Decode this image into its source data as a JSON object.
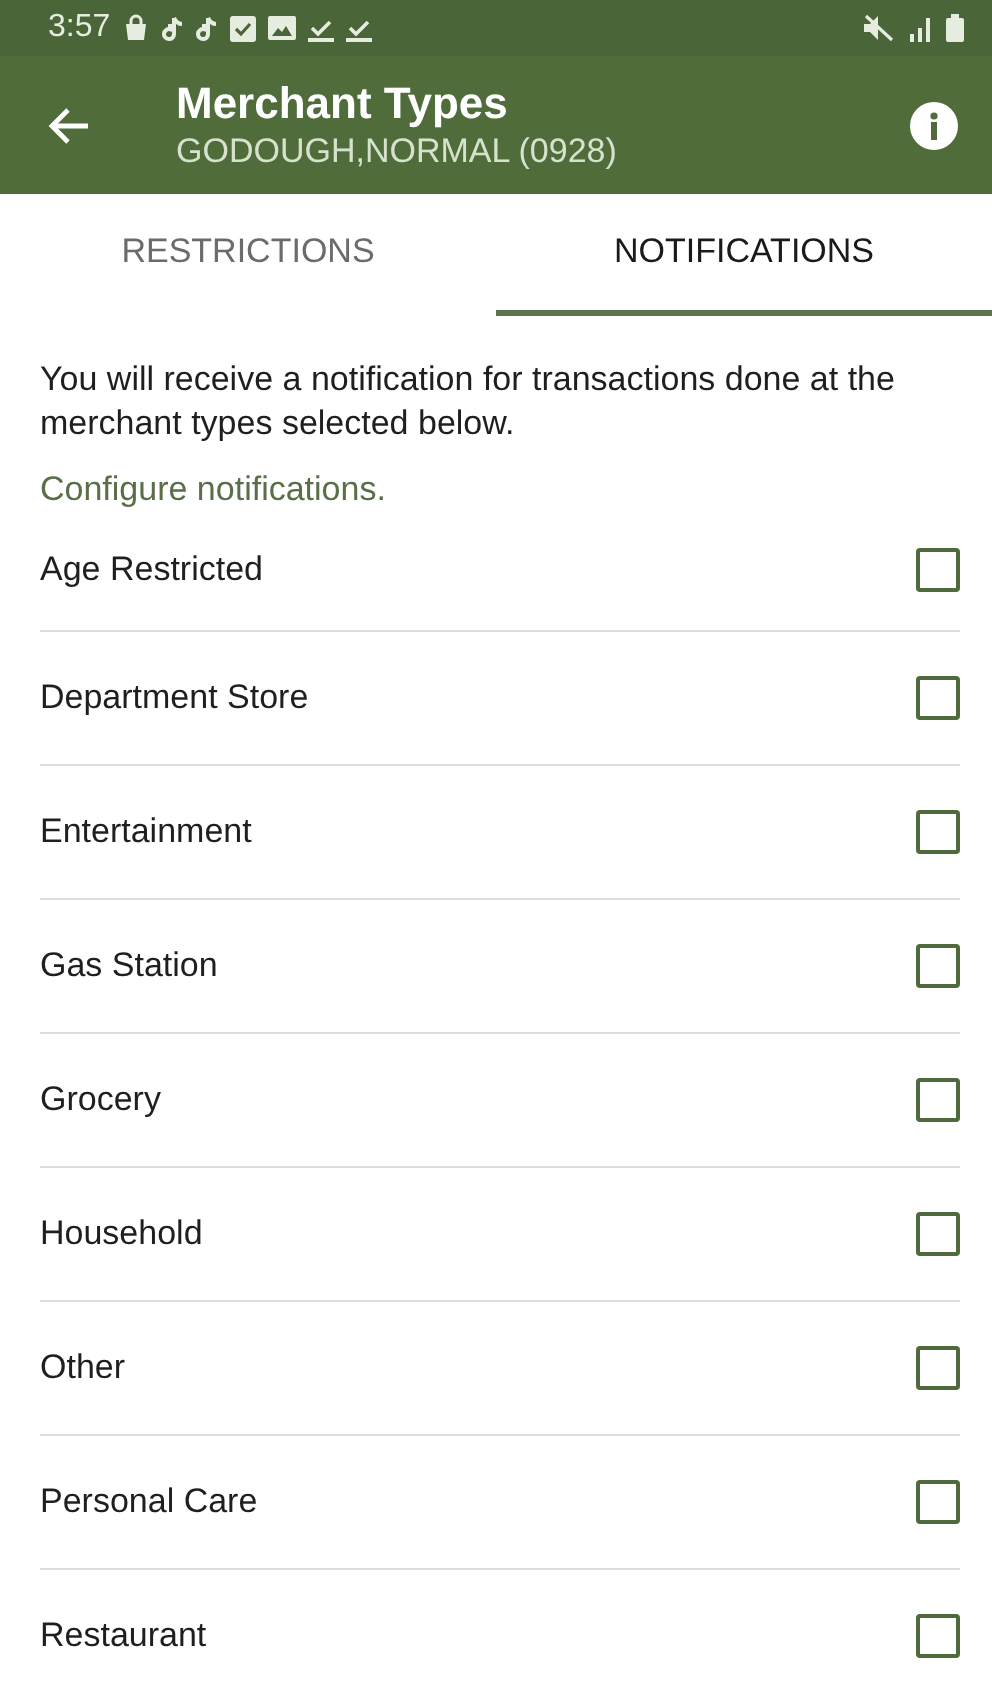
{
  "status_bar": {
    "time": "3:57"
  },
  "header": {
    "title": "Merchant Types",
    "subtitle": "GODOUGH,NORMAL (0928)"
  },
  "tabs": [
    {
      "label": "RESTRICTIONS",
      "selected": false
    },
    {
      "label": "NOTIFICATIONS",
      "selected": true
    }
  ],
  "description": "You will receive a notification for transactions done at the merchant types selected below.",
  "configure_link": "Configure notifications.",
  "merchant_types": [
    {
      "label": "Age Restricted",
      "checked": false
    },
    {
      "label": "Department Store",
      "checked": false
    },
    {
      "label": "Entertainment",
      "checked": false
    },
    {
      "label": "Gas Station",
      "checked": false
    },
    {
      "label": "Grocery",
      "checked": false
    },
    {
      "label": "Household",
      "checked": false
    },
    {
      "label": "Other",
      "checked": false
    },
    {
      "label": "Personal Care",
      "checked": false
    },
    {
      "label": "Restaurant",
      "checked": false
    }
  ]
}
